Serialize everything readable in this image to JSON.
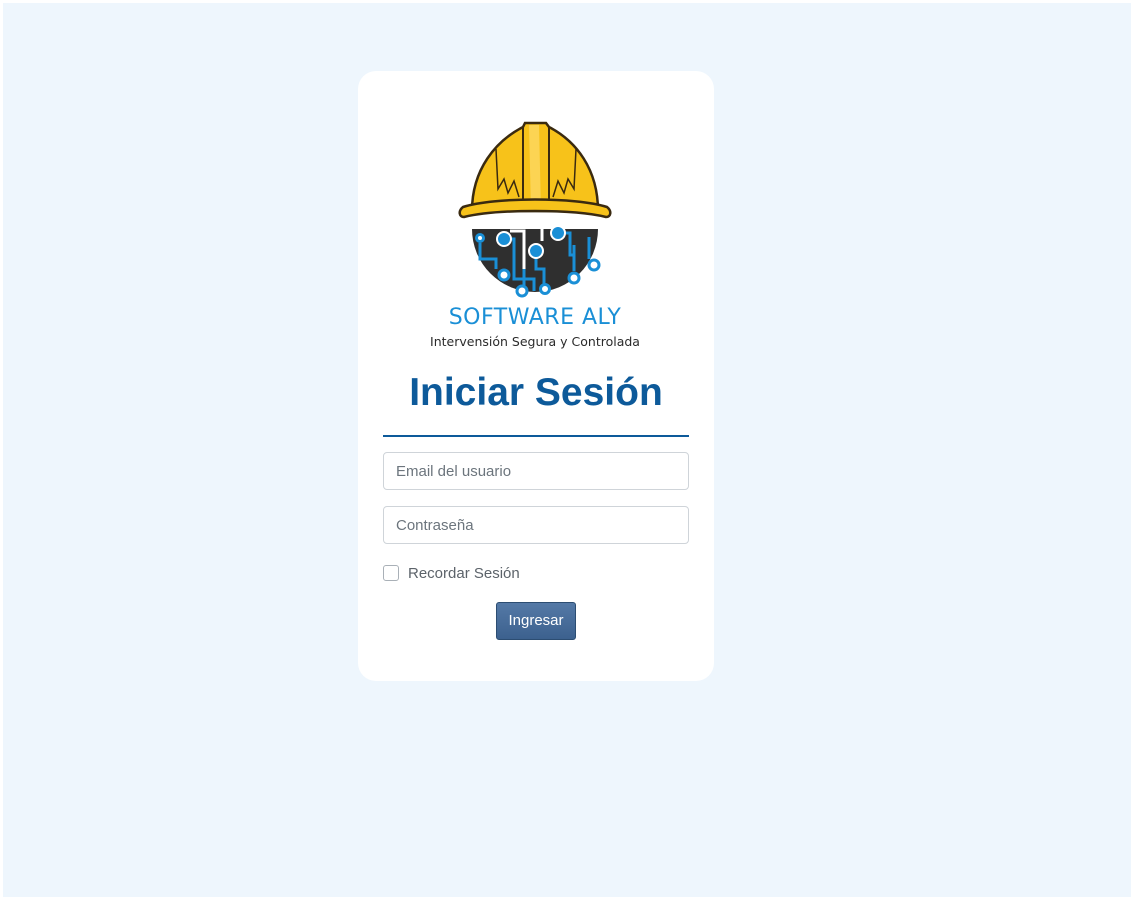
{
  "brand": {
    "name": "SOFTWARE ALY",
    "tagline": "Intervensión Segura y Controlada"
  },
  "login": {
    "title": "Iniciar Sesión",
    "email_placeholder": "Email del usuario",
    "password_placeholder": "Contraseña",
    "remember_label": "Recordar Sesión",
    "remember_checked": false,
    "submit_label": "Ingresar"
  },
  "colors": {
    "background": "#eef6fd",
    "title": "#0d5a9a",
    "brand": "#1a8fd6",
    "helmet": "#f7c21a",
    "button": "#4a6f9c"
  },
  "icons": {
    "logo": "hard-hat-circuit-icon"
  }
}
